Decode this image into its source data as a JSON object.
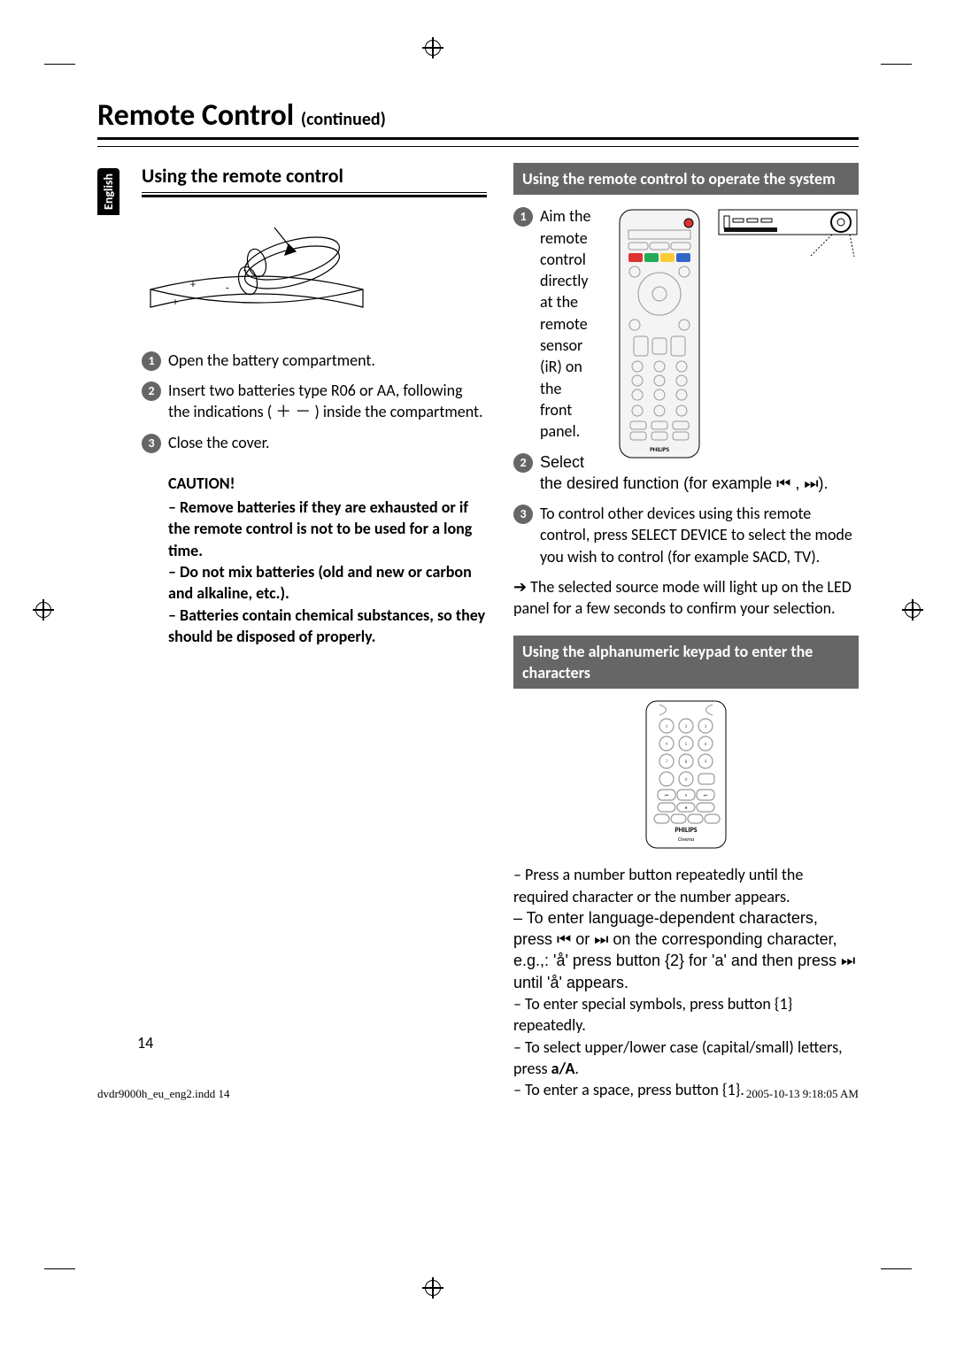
{
  "title_main": "Remote Control",
  "title_sub": "(continued)",
  "lang_tab": "English",
  "left": {
    "section_heading": "Using the remote control",
    "steps": [
      "Open the battery compartment.",
      "Insert two batteries type R06 or AA, following the indications ( ＋ － ) inside the compartment.",
      "Close the cover."
    ],
    "caution_title": "CAUTION!",
    "caution_items": [
      "– Remove batteries if they are exhausted or if the remote control is not to be used for a long time.",
      "– Do not mix batteries (old and new or carbon and alkaline, etc.).",
      "– Batteries contain chemical substances, so they should be disposed of properly."
    ]
  },
  "right": {
    "banner1": "Using the remote control to operate the system",
    "steps": [
      "Aim the remote control directly at the remote sensor (iR) on the front panel.",
      "Select the desired function (for example ⏮ , ⏭).",
      "To control other devices using this remote control, press SELECT DEVICE to select the mode you wish to control (for example SACD, TV)."
    ],
    "arrow_note": "➔ The selected source mode will light up on the LED panel for a few seconds to confirm your selection.",
    "banner2": "Using the alphanumeric keypad to enter the characters",
    "keypad_brand": "PHILIPS",
    "bullets": [
      "–  Press a number button repeatedly until the required character or the number appears.",
      "–  To enter language-dependent characters, press ⏮ or ⏭ on the corresponding character, e.g.,: 'å' press button {2} for 'a' and then press ⏭ until 'å' appears.",
      "–  To enter special symbols, press button {1} repeatedly.",
      "–  To select upper/lower case (capital/small) letters, press a/A.",
      "–  To enter a space, press button {1}."
    ]
  },
  "page_number": "14",
  "footer_left": "dvdr9000h_eu_eng2.indd   14",
  "footer_right": "2005-10-13   9:18:05 AM"
}
